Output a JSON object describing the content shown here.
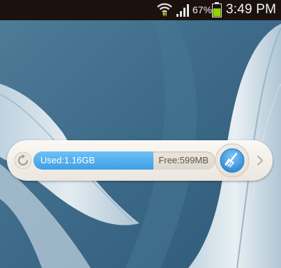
{
  "status_bar": {
    "battery_percent": "67%",
    "time": "3:49 PM",
    "wifi_icon": "wifi-icon",
    "signal_icon": "signal-icon",
    "battery_icon": "battery-icon",
    "battery_level": 0.67,
    "battery_color": "#8fd400"
  },
  "memory_widget": {
    "used_label": "Used:1.16GB",
    "free_label": "Free:599MB",
    "used_fraction": 0.66,
    "bar_color": "#4aa8ec",
    "refresh_icon": "refresh-icon",
    "clean_icon": "broom-icon",
    "arrow_icon": "chevron-right-icon"
  }
}
